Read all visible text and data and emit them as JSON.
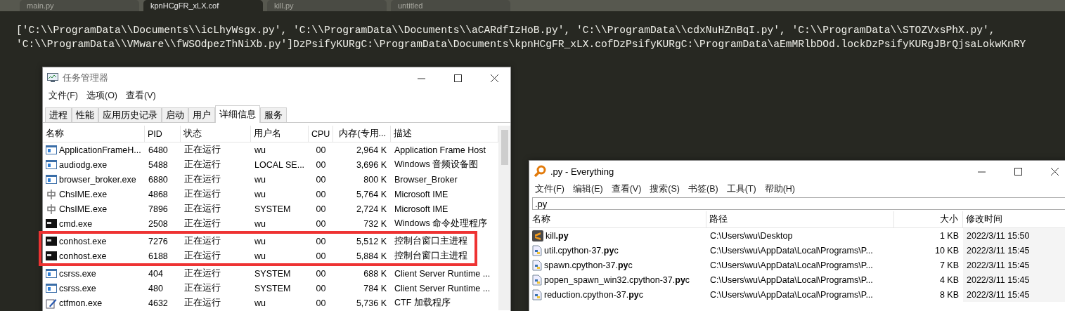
{
  "editor": {
    "tabs": [
      {
        "label": "main.py",
        "selected": false
      },
      {
        "label": "kpnHCgFR_xLX.cof",
        "selected": true
      },
      {
        "label": "kill.py",
        "selected": false
      },
      {
        "label": "untitled",
        "selected": false
      }
    ],
    "lines": [
      "['C:\\\\ProgramData\\\\Documents\\\\icLhyWsgx.py', 'C:\\\\ProgramData\\\\Documents\\\\aCARdfIzHoB.py', 'C:\\\\ProgramData\\\\cdxNuHZnBqI.py', 'C:\\\\ProgramData\\\\STOZVxsPhX.py',",
      "'C:\\\\ProgramData\\\\VMware\\\\fWSOdpezThNiXb.py']DzPsifyKURgC:\\ProgramData\\Documents\\kpnHCgFR_xLX.cofDzPsifyKURgC:\\ProgramData\\aEmMRlbDOd.lockDzPsifyKURgJBrQjsaLokwKnRY"
    ]
  },
  "task_manager": {
    "title": "任务管理器",
    "menu": [
      "文件(F)",
      "选项(O)",
      "查看(V)"
    ],
    "tabs": [
      {
        "label": "进程",
        "selected": false
      },
      {
        "label": "性能",
        "selected": false
      },
      {
        "label": "应用历史记录",
        "selected": false
      },
      {
        "label": "启动",
        "selected": false
      },
      {
        "label": "用户",
        "selected": false
      },
      {
        "label": "详细信息",
        "selected": true
      },
      {
        "label": "服务",
        "selected": false
      }
    ],
    "columns": [
      "名称",
      "PID",
      "状态",
      "用户名",
      "CPU",
      "内存(专用...",
      "描述"
    ],
    "rows": [
      {
        "kind": "app",
        "highlighted": false,
        "cells": [
          "ApplicationFrameH...",
          "6480",
          "正在运行",
          "wu",
          "00",
          "2,964 K",
          "Application Frame Host"
        ]
      },
      {
        "kind": "app",
        "highlighted": false,
        "cells": [
          "audiodg.exe",
          "5488",
          "正在运行",
          "LOCAL SE...",
          "00",
          "3,696 K",
          "Windows 音频设备图"
        ]
      },
      {
        "kind": "app",
        "highlighted": false,
        "cells": [
          "browser_broker.exe",
          "6880",
          "正在运行",
          "wu",
          "00",
          "800 K",
          "Browser_Broker"
        ]
      },
      {
        "kind": "ime",
        "highlighted": false,
        "cells": [
          "ChsIME.exe",
          "4868",
          "正在运行",
          "wu",
          "00",
          "5,764 K",
          "Microsoft IME"
        ]
      },
      {
        "kind": "ime",
        "highlighted": false,
        "cells": [
          "ChsIME.exe",
          "7896",
          "正在运行",
          "SYSTEM",
          "00",
          "2,724 K",
          "Microsoft IME"
        ]
      },
      {
        "kind": "console",
        "highlighted": false,
        "cells": [
          "cmd.exe",
          "2508",
          "正在运行",
          "wu",
          "00",
          "732 K",
          "Windows 命令处理程序"
        ]
      },
      {
        "kind": "console",
        "highlighted": true,
        "cells": [
          "conhost.exe",
          "7276",
          "正在运行",
          "wu",
          "00",
          "5,512 K",
          "控制台窗口主进程"
        ]
      },
      {
        "kind": "console",
        "highlighted": true,
        "cells": [
          "conhost.exe",
          "6188",
          "正在运行",
          "wu",
          "00",
          "5,884 K",
          "控制台窗口主进程"
        ]
      },
      {
        "kind": "app",
        "highlighted": false,
        "cells": [
          "csrss.exe",
          "404",
          "正在运行",
          "SYSTEM",
          "00",
          "688 K",
          "Client Server Runtime ..."
        ]
      },
      {
        "kind": "app",
        "highlighted": false,
        "cells": [
          "csrss.exe",
          "480",
          "正在运行",
          "SYSTEM",
          "00",
          "784 K",
          "Client Server Runtime ..."
        ]
      },
      {
        "kind": "pen",
        "highlighted": false,
        "cells": [
          "ctfmon.exe",
          "4632",
          "正在运行",
          "wu",
          "00",
          "5,736 K",
          "CTF 加载程序"
        ]
      }
    ]
  },
  "everything": {
    "title": ".py - Everything",
    "menu": [
      "文件(F)",
      "编辑(E)",
      "查看(V)",
      "搜索(S)",
      "书签(B)",
      "工具(T)",
      "帮助(H)"
    ],
    "search": {
      "value": ".py"
    },
    "columns": [
      "名称",
      "路径",
      "大小",
      "修改时间"
    ],
    "rows": [
      {
        "kind": "sublime",
        "cells": [
          "kill**.py**",
          "C:\\Users\\wu\\Desktop",
          "1 KB",
          "2022/3/11 15:50"
        ]
      },
      {
        "kind": "python",
        "cells": [
          "util.cpython-37.**py**c",
          "C:\\Users\\wu\\AppData\\Local\\Programs\\P...",
          "10 KB",
          "2022/3/11 15:45"
        ]
      },
      {
        "kind": "python",
        "cells": [
          "spawn.cpython-37.**py**c",
          "C:\\Users\\wu\\AppData\\Local\\Programs\\P...",
          "7 KB",
          "2022/3/11 15:45"
        ]
      },
      {
        "kind": "python",
        "cells": [
          "popen_spawn_win32.cpython-37.**py**c",
          "C:\\Users\\wu\\AppData\\Local\\Programs\\P...",
          "4 KB",
          "2022/3/11 15:45"
        ]
      },
      {
        "kind": "python",
        "cells": [
          "reduction.cpython-37.**py**c",
          "C:\\Users\\wu\\AppData\\Local\\Programs\\P...",
          "8 KB",
          "2022/3/11 15:45"
        ]
      }
    ]
  }
}
